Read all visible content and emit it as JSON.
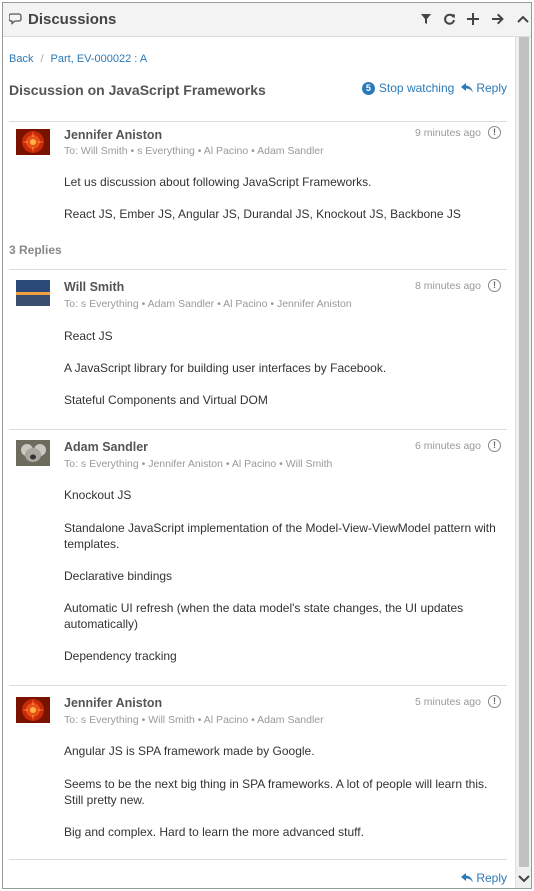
{
  "header": {
    "title": "Discussions",
    "icons": [
      "chat-icon",
      "filter-icon",
      "refresh-icon",
      "plus-icon",
      "arrow-right-icon",
      "chevron-up-icon"
    ]
  },
  "breadcrumb": {
    "back": "Back",
    "part": "Part, EV-000022 : A"
  },
  "discussion": {
    "title": "Discussion on JavaScript Frameworks",
    "watch_count": "5",
    "stop_watching": "Stop watching",
    "reply": "Reply"
  },
  "replies_label": "3 Replies",
  "posts": [
    {
      "author": "Jennifer Aniston",
      "to": "To: Will Smith • s Everything • Al Pacino • Adam Sandler",
      "time": "9 minutes ago",
      "paragraphs": [
        "Let us discussion about following JavaScript Frameworks.",
        "React JS, Ember JS, Angular JS, Durandal JS, Knockout JS, Backbone JS"
      ]
    },
    {
      "author": "Will Smith",
      "to": "To: s Everything • Adam Sandler • Al Pacino • Jennifer Aniston",
      "time": "8 minutes ago",
      "paragraphs": [
        "React JS",
        "A JavaScript library for building user interfaces by Facebook.",
        "Stateful Components and Virtual DOM"
      ]
    },
    {
      "author": "Adam Sandler",
      "to": "To: s Everything • Jennifer Aniston • Al Pacino • Will Smith",
      "time": "6 minutes ago",
      "paragraphs": [
        "Knockout JS",
        "Standalone JavaScript implementation of the Model-View-ViewModel pattern with templates.",
        "Declarative bindings",
        "Automatic UI refresh (when the data model's state changes, the UI updates automatically)",
        "Dependency tracking"
      ]
    },
    {
      "author": "Jennifer Aniston",
      "to": "To: s Everything • Will Smith • Al Pacino • Adam Sandler",
      "time": "5 minutes ago",
      "paragraphs": [
        "Angular JS is SPA framework made by Google.",
        "Seems to be the next big thing in SPA frameworks. A lot of people will learn this. Still pretty new.",
        "Big and complex. Hard to learn the more advanced stuff."
      ]
    }
  ],
  "footer": {
    "reply": "Reply"
  },
  "colors": {
    "link": "#2a7ab8",
    "header_bg": "#f3f3f3",
    "muted": "#999999"
  }
}
